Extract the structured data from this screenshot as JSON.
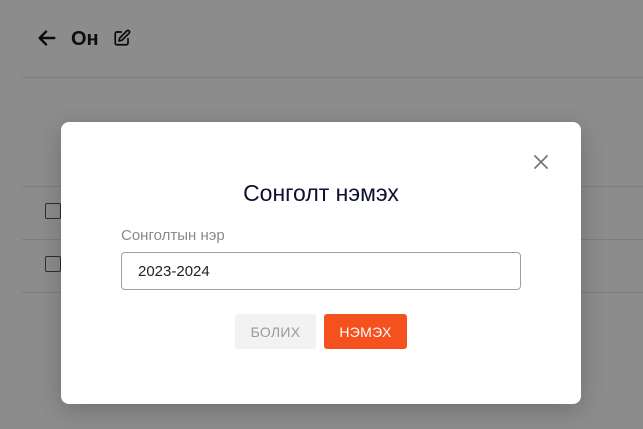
{
  "page": {
    "title": "Он"
  },
  "modal": {
    "title": "Сонголт нэмэх",
    "field_label": "Сонголтын нэр",
    "field_value": "2023-2024",
    "cancel_label": "БОЛИХ",
    "add_label": "НЭМЭХ"
  },
  "colors": {
    "accent": "#f4511e",
    "title_text": "#0d1030",
    "overlay": "rgba(0,0,0,0.45)"
  },
  "icons": {
    "back": "arrow-left-icon",
    "edit": "edit-icon",
    "close": "close-icon"
  }
}
